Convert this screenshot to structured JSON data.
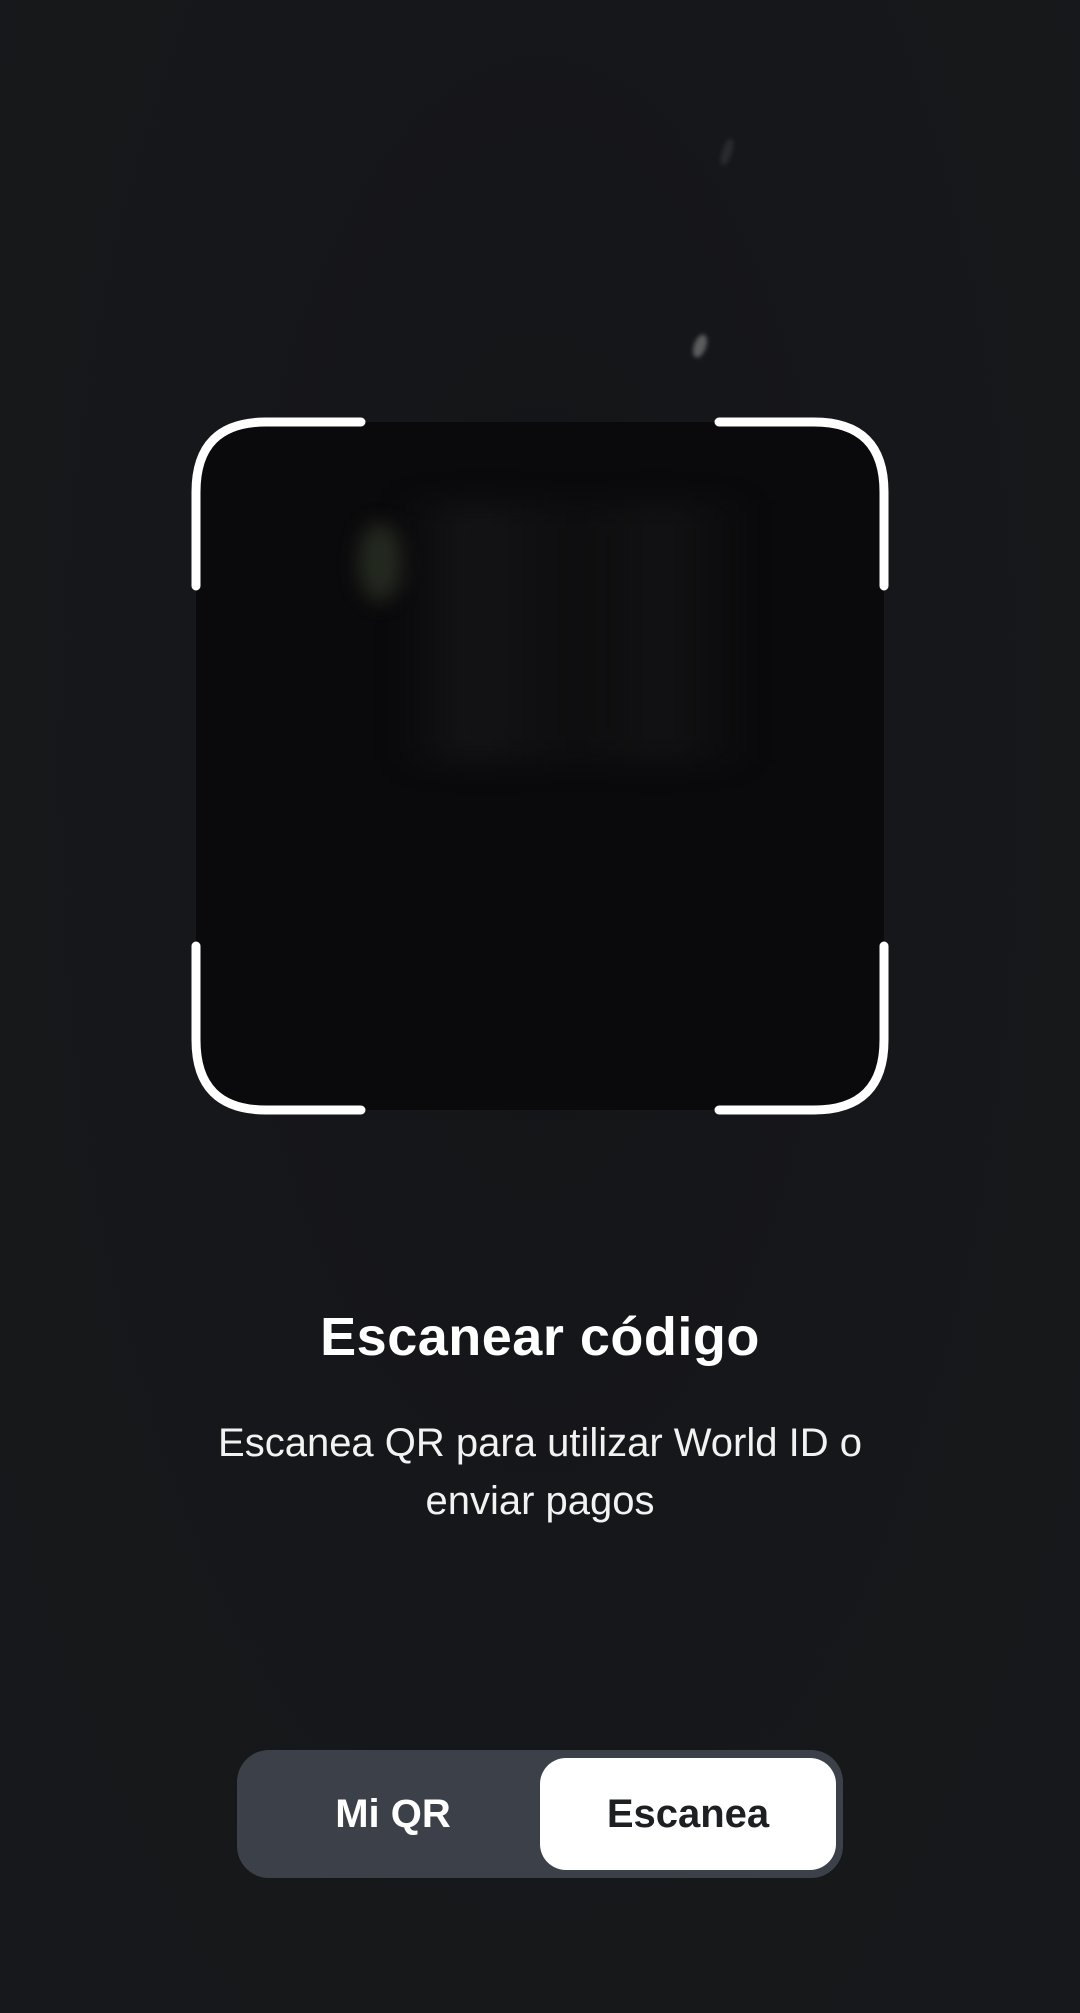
{
  "scanner": {
    "title": "Escanear código",
    "subtitle_line1": "Escanea QR para utilizar World ID o",
    "subtitle_line2": "enviar pagos"
  },
  "mode_switch": {
    "options": [
      "Mi QR",
      "Escanea"
    ],
    "selected": "Escanea"
  },
  "colors": {
    "background": "#16171a",
    "frame": "#ffffff",
    "switch_track": "#3c4149",
    "switch_active": "#ffffff"
  }
}
